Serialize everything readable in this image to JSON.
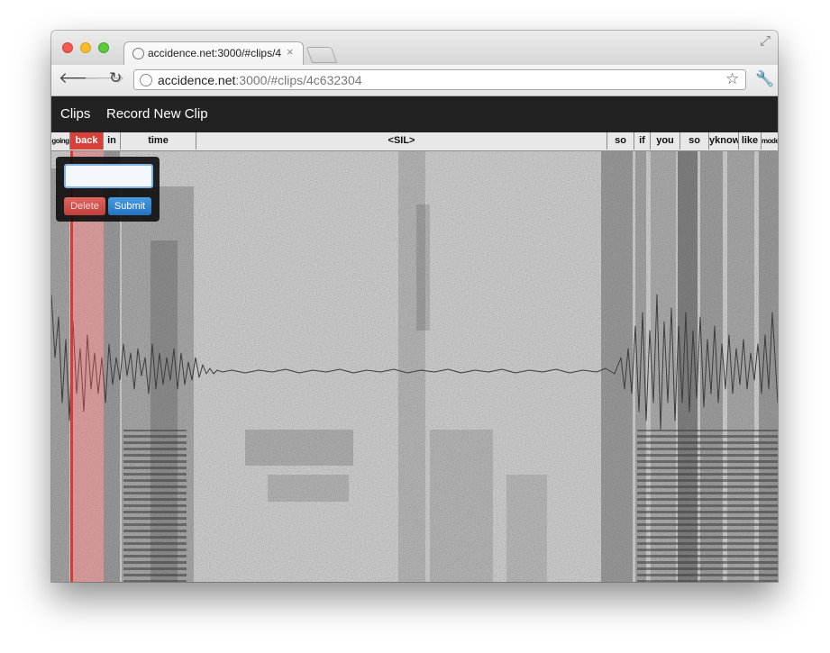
{
  "browser": {
    "tab_title": "accidence.net:3000/#clips/4",
    "tab_close": "×",
    "url_host": "accidence.net",
    "url_rest": ":3000/#clips/4c632304"
  },
  "appbar": {
    "brand": "Clips",
    "record_link": "Record New Clip"
  },
  "words": [
    "going",
    "back",
    "in",
    "time",
    "<SIL>",
    "so",
    "if",
    "you",
    "so",
    "yknow",
    "like",
    "modern"
  ],
  "selected_word_index": 1,
  "popover": {
    "input_value": "",
    "delete_label": "Delete",
    "submit_label": "Submit"
  },
  "colors": {
    "selection": "#d9403a",
    "submit": "#2373c2",
    "appbar": "#222222"
  }
}
